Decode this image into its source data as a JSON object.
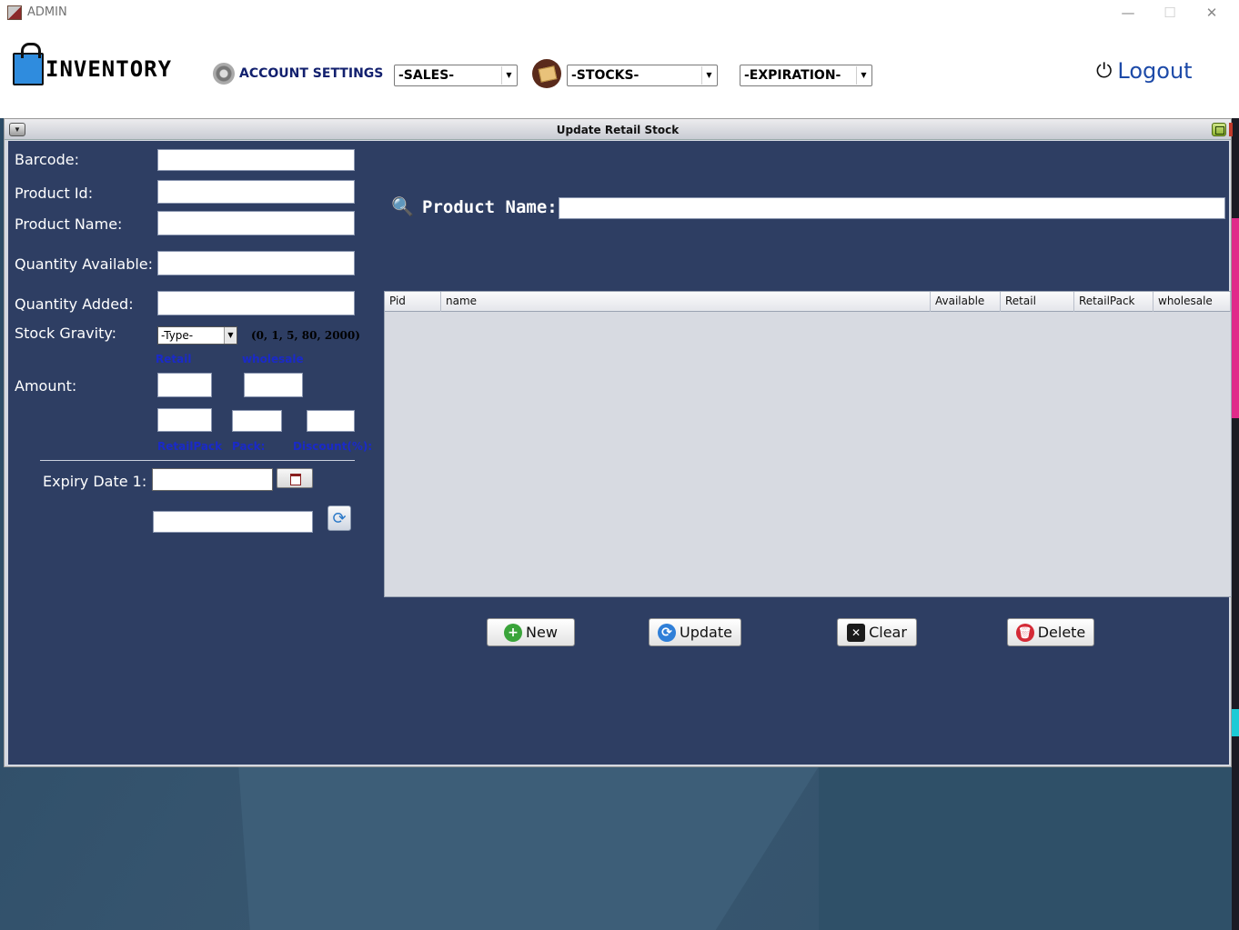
{
  "window": {
    "title": "ADMIN",
    "minimize": "—",
    "maximize": "☐",
    "close": "✕"
  },
  "menubar": {
    "logo_text": "INVENTORY",
    "account_settings": "ACCOUNT SETTINGS",
    "sales": "-SALES-",
    "stocks": "-STOCKS-",
    "expiration": "-EXPIRATION-",
    "logout": "Logout"
  },
  "frame": {
    "title": "Update Retail Stock"
  },
  "form": {
    "barcode_label": "Barcode:",
    "product_id_label": "Product Id:",
    "product_name_label": "Product Name:",
    "quantity_available_label": "Quantity Available:",
    "quantity_added_label": "Quantity Added:",
    "stock_gravity_label": "Stock Gravity:",
    "stock_gravity_value": "-Type-",
    "gravity_hint": "(0, 1, 5, 80, 2000)",
    "retail_label": "Retail",
    "wholesale_label": "wholesale",
    "amount_label": "Amount:",
    "retailpack_label": "RetailPack",
    "pack_label": "Pack:",
    "discount_label": "Discount(%):",
    "expiry_label": "Expiry Date 1:"
  },
  "search": {
    "label": "Product Name:"
  },
  "table": {
    "columns": [
      "Pid",
      "name",
      "Available",
      "Retail",
      "RetailPack",
      "wholesale"
    ]
  },
  "buttons": {
    "new": "New",
    "update": "Update",
    "clear": "Clear",
    "delete": "Delete"
  },
  "icons": [
    "gear-icon",
    "stock-icon",
    "power-icon",
    "search-icon",
    "calendar-icon",
    "refresh-icon",
    "add-icon",
    "update-icon",
    "clear-icon",
    "delete-icon"
  ],
  "colors": {
    "panel": "#2e3e63",
    "accent_blue": "#1d4aa8",
    "label_blue": "#1a2ac8"
  }
}
